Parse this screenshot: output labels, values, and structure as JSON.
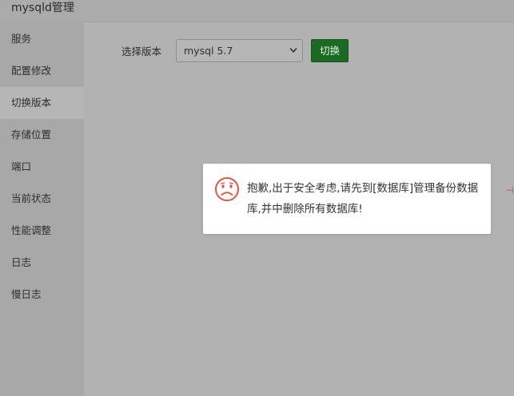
{
  "window": {
    "title": "mysqld管理"
  },
  "sidebar": {
    "items": [
      {
        "label": "服务"
      },
      {
        "label": "配置修改"
      },
      {
        "label": "切换版本"
      },
      {
        "label": "存储位置"
      },
      {
        "label": "端口"
      },
      {
        "label": "当前状态"
      },
      {
        "label": "性能调整"
      },
      {
        "label": "日志"
      },
      {
        "label": "慢日志"
      }
    ],
    "active_index": 2
  },
  "version_panel": {
    "label": "选择版本",
    "selected_version": "mysql 5.7",
    "switch_button_label": "切换"
  },
  "toast": {
    "icon": "sad-face-icon",
    "message": "抱歉,出于安全考虑,请先到[数据库]管理备份数据库,并中删除所有数据库!"
  },
  "colors": {
    "accent_green": "#1b6a22",
    "error_icon": "#e0553f",
    "overlay_gray": "#b2b2b2"
  }
}
